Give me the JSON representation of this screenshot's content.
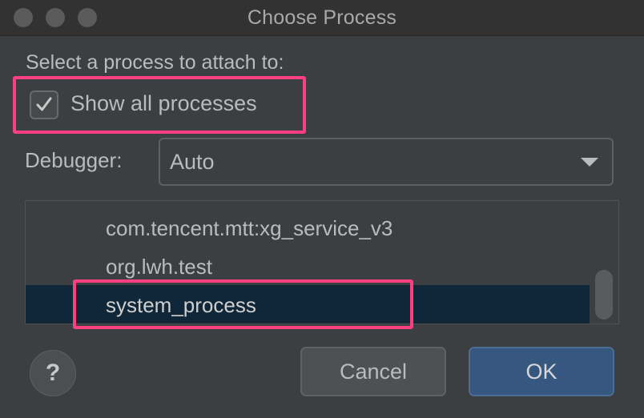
{
  "window": {
    "title": "Choose Process"
  },
  "prompt": "Select a process to attach to:",
  "show_all": {
    "label": "Show all processes",
    "checked": true
  },
  "debugger": {
    "label": "Debugger:",
    "value": "Auto"
  },
  "processes": [
    "com.tencent.mtt:xg_service_v3",
    "org.lwh.test",
    "system_process"
  ],
  "selected_index": 2,
  "buttons": {
    "help": "?",
    "cancel": "Cancel",
    "ok": "OK"
  },
  "colors": {
    "highlight": "#ff3f7f",
    "selection": "#0f2738",
    "ok_button": "#365880"
  }
}
